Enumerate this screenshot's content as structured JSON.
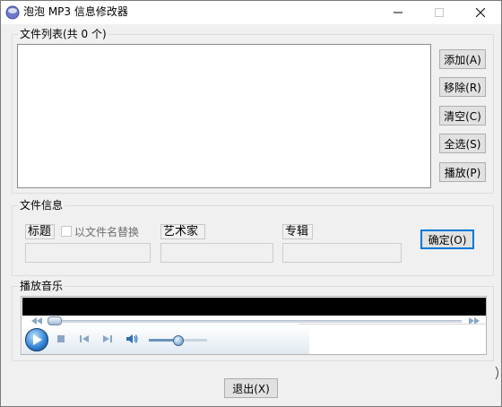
{
  "window": {
    "title": "泡泡 MP3 信息修改器",
    "minimize_icon": "minimize-icon",
    "maximize_icon": "maximize-icon",
    "close_icon": "close-icon",
    "app_icon": "app-icon"
  },
  "file_list": {
    "group_label": "文件列表(共 0 个)",
    "items": []
  },
  "side_buttons": {
    "add": "添加(A)",
    "remove": "移除(R)",
    "clear": "清空(C)",
    "select_all": "全选(S)",
    "play": "播放(P)"
  },
  "file_info": {
    "group_label": "文件信息",
    "title_label": "标题",
    "replace_with_filename": "以文件名替换",
    "replace_checked": false,
    "artist_label": "艺术家",
    "album_label": "专辑",
    "title_value": "",
    "artist_value": "",
    "album_value": "",
    "ok_button": "确定(O)"
  },
  "player": {
    "group_label": "播放音乐",
    "progress": 0,
    "volume": 0.48,
    "icons": {
      "rewind": "rewind-icon",
      "fast_forward": "fast-forward-icon",
      "play": "play-icon",
      "stop": "stop-icon",
      "previous": "previous-track-icon",
      "next": "next-track-icon",
      "volume": "volume-icon"
    }
  },
  "footer": {
    "exit_button": "退出(X)"
  },
  "colors": {
    "window_bg": "#f0f0f0",
    "accent": "#0078d7",
    "button_bg": "#e1e1e1"
  }
}
